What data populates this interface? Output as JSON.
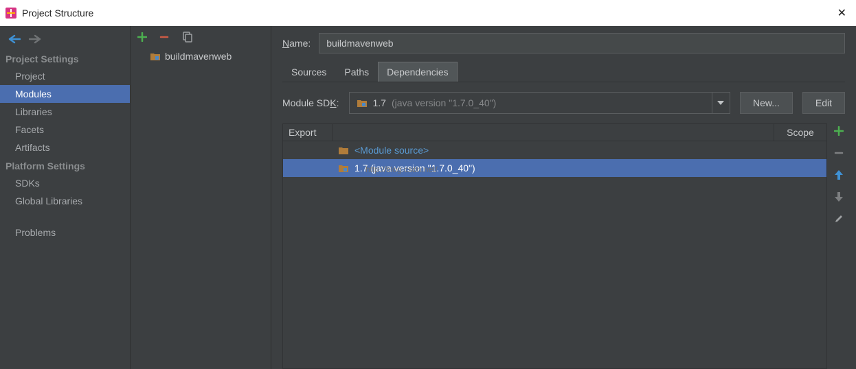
{
  "window": {
    "title": "Project Structure"
  },
  "nav": {
    "sections": [
      {
        "label": "Project Settings",
        "items": [
          "Project",
          "Modules",
          "Libraries",
          "Facets",
          "Artifacts"
        ]
      },
      {
        "label": "Platform Settings",
        "items": [
          "SDKs",
          "Global Libraries"
        ]
      }
    ],
    "problems": "Problems",
    "selected": "Modules"
  },
  "module_tree": {
    "name": "buildmavenweb"
  },
  "detail": {
    "name_label": "Name:",
    "name_value": "buildmavenweb",
    "tabs": [
      "Sources",
      "Paths",
      "Dependencies"
    ],
    "selected_tab": "Dependencies",
    "sdk_label": "Module SDK:",
    "sdk_name": "1.7",
    "sdk_version": "(java version \"1.7.0_40\")",
    "new_btn": "New...",
    "edit_btn": "Edit",
    "table": {
      "headers": [
        "Export",
        "",
        "Scope"
      ],
      "rows": [
        {
          "type": "module_source",
          "label": "<Module source>"
        },
        {
          "type": "sdk",
          "label": "1.7 (java version \"1.7.0_40\")",
          "selected": true
        }
      ]
    },
    "watermark": "http://blog.csdn.net/"
  }
}
